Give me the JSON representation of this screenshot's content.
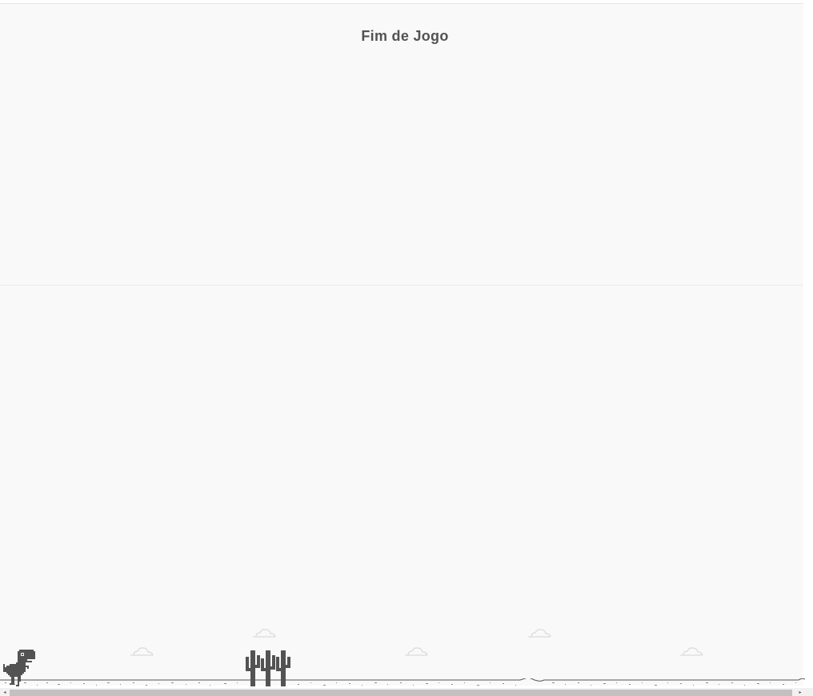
{
  "game": {
    "game_over_text": "Fim de Jogo",
    "colors": {
      "sprite": "#535353",
      "background": "#f9f9f9",
      "cloud": "#dadada"
    },
    "icons": {
      "player": "trex-icon",
      "obstacle": "cactus-icon",
      "sky": "cloud-icon"
    }
  },
  "scrollbar": {
    "left_arrow": "◂",
    "right_arrow": "▸"
  }
}
